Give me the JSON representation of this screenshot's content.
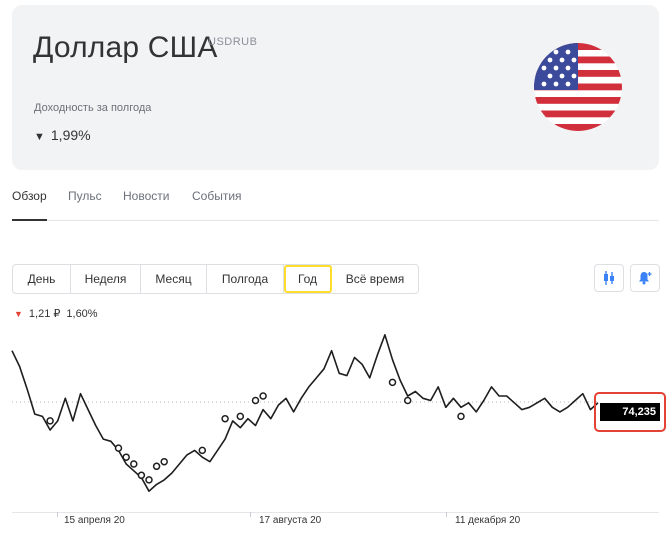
{
  "header": {
    "title": "Доллар США",
    "ticker": "USDRUB",
    "yield_label": "Доходность за полгода",
    "yield_arrow": "▼",
    "yield_value": "1,99%"
  },
  "tabs": [
    {
      "label": "Обзор",
      "active": true
    },
    {
      "label": "Пульс",
      "active": false
    },
    {
      "label": "Новости",
      "active": false
    },
    {
      "label": "События",
      "active": false
    }
  ],
  "periods": [
    {
      "label": "День",
      "active": false
    },
    {
      "label": "Неделя",
      "active": false
    },
    {
      "label": "Месяц",
      "active": false
    },
    {
      "label": "Полгода",
      "active": false
    },
    {
      "label": "Год",
      "active": true
    },
    {
      "label": "Всё время",
      "active": false
    }
  ],
  "tools": {
    "chart_type_icon": "candles-icon",
    "alert_icon": "bell-plus-icon"
  },
  "change": {
    "arrow": "▼",
    "amount": "1,21 ₽",
    "percent": "1,60%"
  },
  "colors": {
    "accent": "#ffdd2d",
    "negative": "#e34234",
    "line": "#1e1e1e",
    "card": "#f2f3f5"
  },
  "chart_data": {
    "type": "line",
    "current_value_label": "74,235",
    "x_tick_labels": [
      "15 апреля 20",
      "17 августа 20",
      "11 декабря 20"
    ],
    "values": [
      76.5,
      75.8,
      74.8,
      73.7,
      73.6,
      73.0,
      73.4,
      74.4,
      73.4,
      74.6,
      73.9,
      73.2,
      72.6,
      72.5,
      72.1,
      71.5,
      71.2,
      70.9,
      70.3,
      70.6,
      70.8,
      71.1,
      71.5,
      71.9,
      72.1,
      71.8,
      71.6,
      72.1,
      72.6,
      73.4,
      73.1,
      73.5,
      73.2,
      73.9,
      73.5,
      74.1,
      74.4,
      73.8,
      74.4,
      74.9,
      75.3,
      75.7,
      76.5,
      75.5,
      75.4,
      76.2,
      75.9,
      75.3,
      76.3,
      77.2,
      76.1,
      75.2,
      74.5,
      74.7,
      74.4,
      74.3,
      74.9,
      74.0,
      74.4,
      74.0,
      74.2,
      73.8,
      74.3,
      74.9,
      74.5,
      74.5,
      74.2,
      73.9,
      74.0,
      74.2,
      74.4,
      74.0,
      73.8,
      74.0,
      74.3,
      74.6,
      73.9,
      74.2
    ],
    "reference_value": 74.235,
    "circle_markers": [
      {
        "i": 5,
        "v": 73.4
      },
      {
        "i": 14,
        "v": 72.2
      },
      {
        "i": 15,
        "v": 71.8
      },
      {
        "i": 16,
        "v": 71.5
      },
      {
        "i": 17,
        "v": 71.0
      },
      {
        "i": 18,
        "v": 70.8
      },
      {
        "i": 19,
        "v": 71.4
      },
      {
        "i": 20,
        "v": 71.6
      },
      {
        "i": 25,
        "v": 72.1
      },
      {
        "i": 28,
        "v": 73.5
      },
      {
        "i": 30,
        "v": 73.6
      },
      {
        "i": 32,
        "v": 74.3
      },
      {
        "i": 33,
        "v": 74.5
      },
      {
        "i": 50,
        "v": 75.1
      },
      {
        "i": 52,
        "v": 74.3
      },
      {
        "i": 59,
        "v": 73.6
      }
    ]
  }
}
